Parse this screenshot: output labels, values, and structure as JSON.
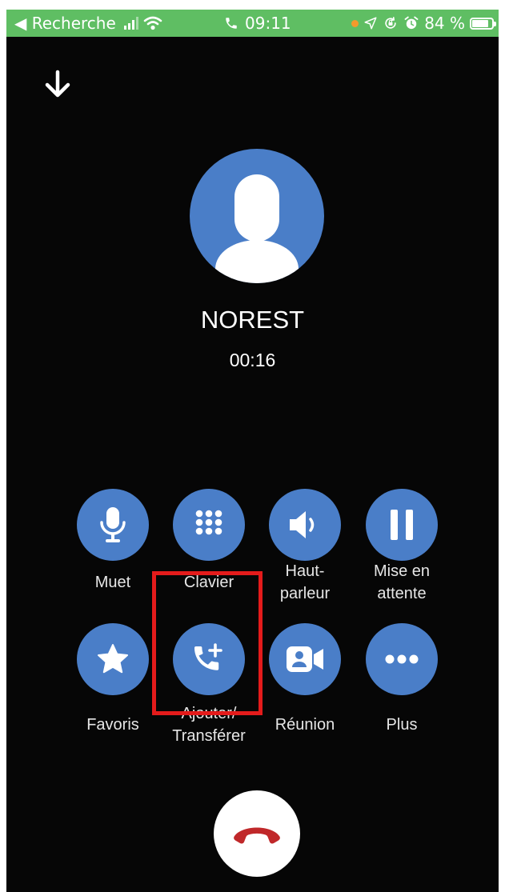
{
  "status_bar": {
    "back_label": "◀ Recherche",
    "time": "09:11",
    "battery": "84 %",
    "battery_level": 0.84,
    "colors": {
      "background": "#5fbe63",
      "location_dot": "#f39a2b"
    },
    "icons": [
      "signal-bars-icon",
      "wifi-icon",
      "phone-icon",
      "location-icon",
      "orientation-lock-icon",
      "alarm-icon",
      "battery-icon"
    ]
  },
  "call": {
    "caller_name": "NOREST",
    "duration": "00:16"
  },
  "controls": {
    "row1": [
      {
        "label": "Muet",
        "icon": "microphone-icon"
      },
      {
        "label": "Clavier",
        "icon": "keypad-icon"
      },
      {
        "label": "Haut-\nparleur",
        "icon": "speaker-icon"
      },
      {
        "label": "Mise en\nattente",
        "icon": "pause-icon"
      }
    ],
    "row2": [
      {
        "label": "Favoris",
        "icon": "star-icon"
      },
      {
        "label": "Ajouter/\nTransférer",
        "icon": "add-call-icon"
      },
      {
        "label": "Réunion",
        "icon": "video-meeting-icon"
      },
      {
        "label": "Plus",
        "icon": "more-dots-icon"
      }
    ]
  },
  "hangup": {
    "icon": "hang-up-icon"
  },
  "colors": {
    "screen_background": "#060606",
    "button_blue": "#4a7ec8",
    "hangup_red": "#c0282a",
    "highlight_red": "#e41b1b"
  }
}
